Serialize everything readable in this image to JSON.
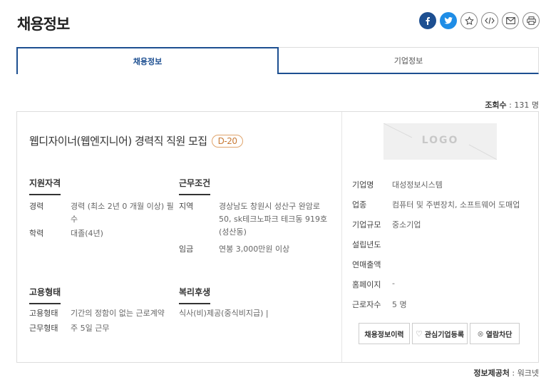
{
  "page": {
    "title": "채용정보"
  },
  "share": [
    {
      "name": "facebook-icon",
      "glyph": "f"
    },
    {
      "name": "twitter-icon",
      "glyph": "t"
    },
    {
      "name": "bookmark-star-icon",
      "glyph": "☆"
    },
    {
      "name": "embed-code-icon",
      "glyph": "</>"
    },
    {
      "name": "email-icon",
      "glyph": "✉"
    },
    {
      "name": "print-icon",
      "glyph": "⎙"
    }
  ],
  "tabs": [
    {
      "label": "채용정보",
      "active": true
    },
    {
      "label": "기업정보",
      "active": false
    }
  ],
  "views": {
    "label": "조회수",
    "value": " : 131 명"
  },
  "job": {
    "title": "웹디자이너(웹엔지니어) 경력직 직원 모집",
    "dday": "D-20"
  },
  "qualification": {
    "heading": "지원자격",
    "career_k": "경력",
    "career_v": "경력 (최소 2년 0 개월 이상) 필수",
    "edu_k": "학력",
    "edu_v": "대졸(4년)"
  },
  "conditions": {
    "heading": "근무조건",
    "region_k": "지역",
    "region_v": "경상남도 창원시 성산구 완암로 50, sk테크노파크 테크동 919호(성산동)",
    "salary_k": "임금",
    "salary_v": "연봉 3,000만원 이상"
  },
  "employment": {
    "heading": "고용형태",
    "type_k": "고용형태",
    "type_v": "기간의 정함이 없는 근로계약",
    "work_k": "근무형태",
    "work_v": "주 5일 근무"
  },
  "welfare": {
    "heading": "복리후생",
    "value": "식사(비)제공(중식비지급) |"
  },
  "company": {
    "logo_text": "LOGO",
    "name_k": "기업명",
    "name_v": "대성정보시스템",
    "industry_k": "업종",
    "industry_v": "컴퓨터 및 주변장치, 소프트웨어 도매업",
    "size_k": "기업규모",
    "size_v": "중소기업",
    "founded_k": "설립년도",
    "founded_v": "",
    "sales_k": "연매출액",
    "sales_v": "",
    "homepage_k": "홈페이지",
    "homepage_v": "-",
    "employees_k": "근로자수",
    "employees_v": "5 명"
  },
  "actions": {
    "jobs_label": "채용정보이력",
    "interest_label": "관심기업등록",
    "block_label": "열람차단"
  },
  "provider": {
    "label": "정보제공처",
    "value": " : 워크넷"
  }
}
